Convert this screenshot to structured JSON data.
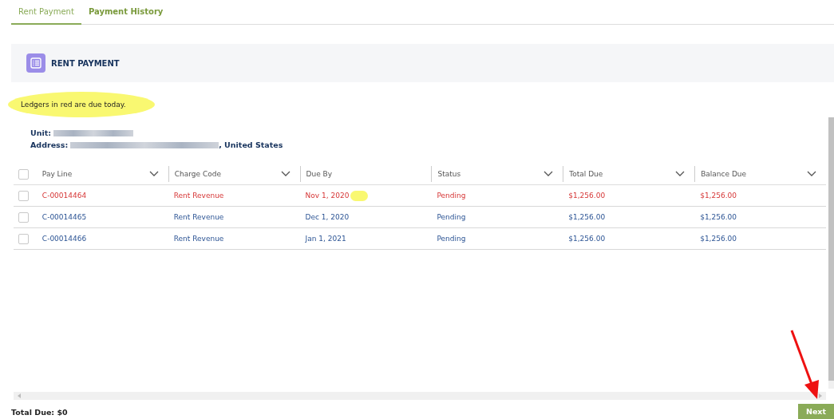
{
  "tabs": [
    {
      "label": "Rent Payment",
      "selected": true
    },
    {
      "label": "Payment History",
      "selected": false
    }
  ],
  "panel": {
    "title": "RENT PAYMENT"
  },
  "note": "Ledgers in red are due today.",
  "unit": {
    "label": "Unit:"
  },
  "address": {
    "label": "Address:",
    "suffix": ", United States"
  },
  "table": {
    "all_checked": false,
    "columns": [
      {
        "label": "Pay Line",
        "sortable": true
      },
      {
        "label": "Charge Code",
        "sortable": true
      },
      {
        "label": "Due By",
        "sortable": false
      },
      {
        "label": "Status",
        "sortable": true
      },
      {
        "label": "Total Due",
        "sortable": true
      },
      {
        "label": "Balance Due",
        "sortable": true
      }
    ],
    "rows": [
      {
        "checked": false,
        "due_today": true,
        "cells": [
          "C-00014464",
          "Rent Revenue",
          "Nov 1, 2020",
          "Pending",
          "$1,256.00",
          "$1,256.00"
        ]
      },
      {
        "checked": false,
        "due_today": false,
        "cells": [
          "C-00014465",
          "Rent Revenue",
          "Dec 1, 2020",
          "Pending",
          "$1,256.00",
          "$1,256.00"
        ]
      },
      {
        "checked": false,
        "due_today": false,
        "cells": [
          "C-00014466",
          "Rent Revenue",
          "Jan 1, 2021",
          "Pending",
          "$1,256.00",
          "$1,256.00"
        ]
      }
    ]
  },
  "footer": {
    "total": "Total Due: $0",
    "next": "Next"
  }
}
